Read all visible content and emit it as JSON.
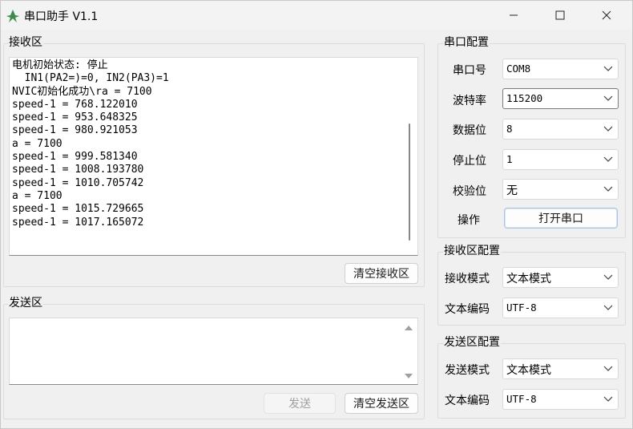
{
  "window": {
    "title": "串口助手 V1.1"
  },
  "receive": {
    "group_title": "接收区",
    "lines": [
      "电机初始状态: 停止",
      "  IN1(PA2=)=0, IN2(PA3)=1",
      "NVIC初始化成功\\ra = 7100",
      "speed-1 = 768.122010",
      "speed-1 = 953.648325",
      "speed-1 = 980.921053",
      "a = 7100",
      "speed-1 = 999.581340",
      "speed-1 = 1008.193780",
      "speed-1 = 1010.705742",
      "a = 7100",
      "speed-1 = 1015.729665",
      "speed-1 = 1017.165072"
    ],
    "clear_button": "清空接收区"
  },
  "send": {
    "group_title": "发送区",
    "input_value": "",
    "send_button": "发送",
    "clear_button": "清空发送区"
  },
  "serial_config": {
    "group_title": "串口配置",
    "port_label": "串口号",
    "port_value": "COM8",
    "baud_label": "波特率",
    "baud_value": "115200",
    "databits_label": "数据位",
    "databits_value": "8",
    "stopbits_label": "停止位",
    "stopbits_value": "1",
    "parity_label": "校验位",
    "parity_value": "无",
    "action_label": "操作",
    "open_button": "打开串口"
  },
  "receive_config": {
    "group_title": "接收区配置",
    "mode_label": "接收模式",
    "mode_value": "文本模式",
    "encoding_label": "文本编码",
    "encoding_value": "UTF-8"
  },
  "send_config": {
    "group_title": "发送区配置",
    "mode_label": "发送模式",
    "mode_value": "文本模式",
    "encoding_label": "文本编码",
    "encoding_value": "UTF-8"
  },
  "colors": {
    "app_icon": "#3c8a4c",
    "accent_border": "#a9c4e3"
  }
}
